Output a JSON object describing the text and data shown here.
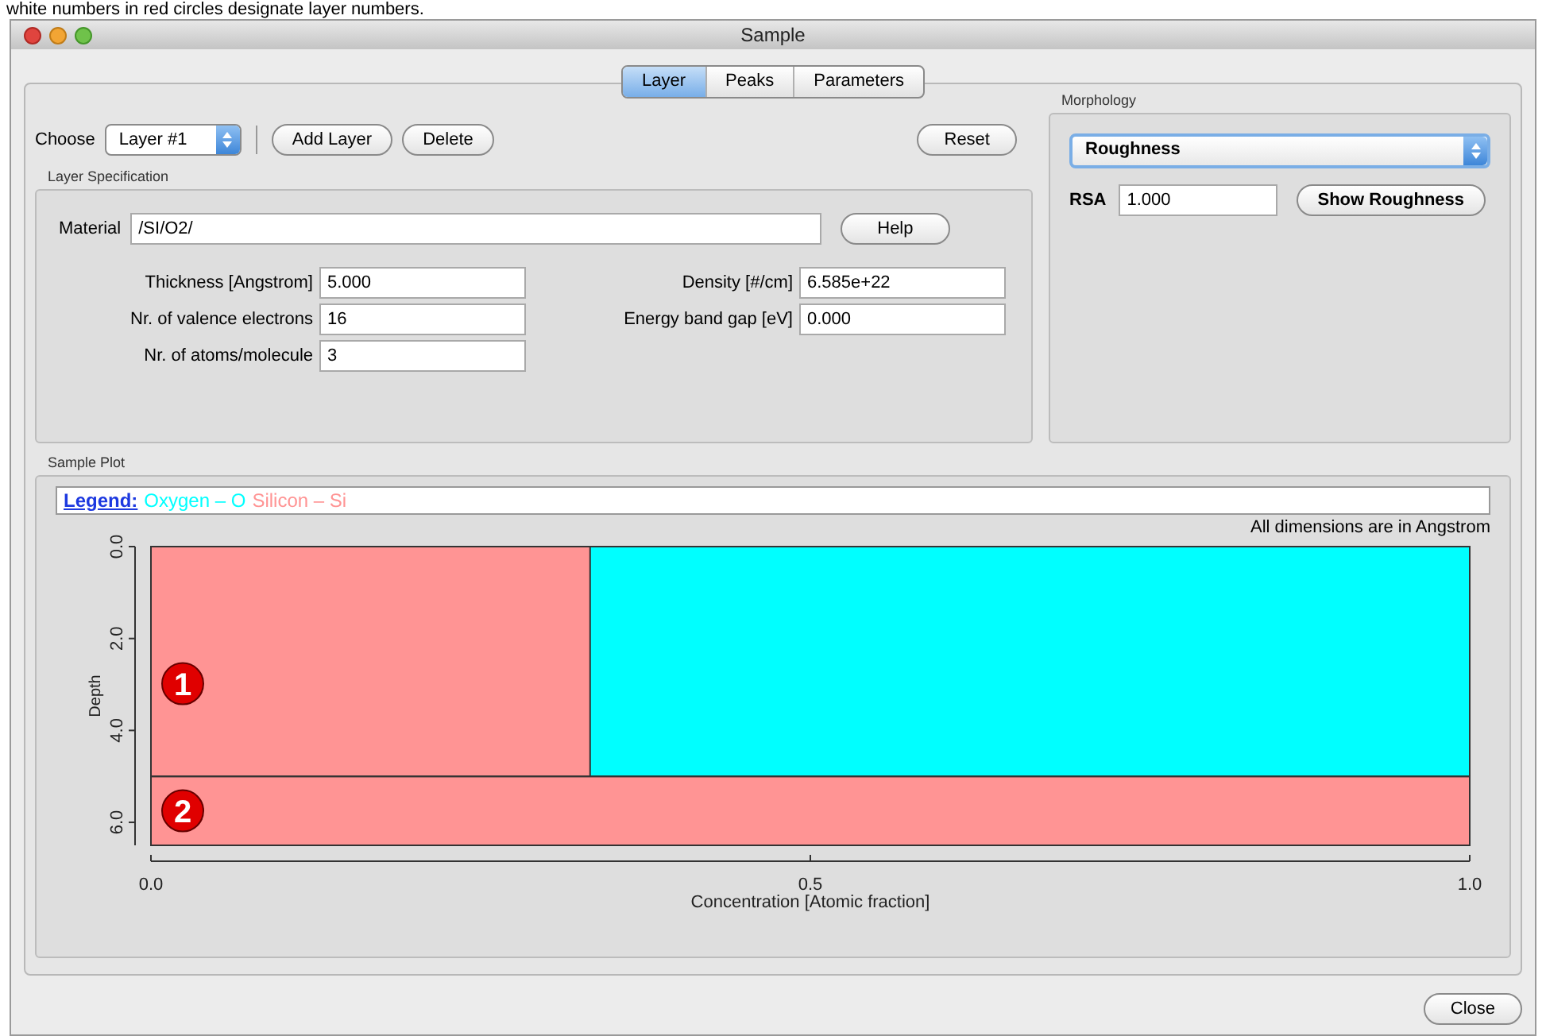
{
  "caption": "white numbers in red circles designate layer numbers.",
  "window": {
    "title": "Sample"
  },
  "tabs": [
    {
      "label": "Layer",
      "selected": true
    },
    {
      "label": "Peaks",
      "selected": false
    },
    {
      "label": "Parameters",
      "selected": false
    }
  ],
  "layer_bar": {
    "choose_label": "Choose",
    "layer_select": "Layer #1",
    "buttons": [
      "Add Layer",
      "Delete"
    ],
    "reset_button": "Reset"
  },
  "layer_specification": {
    "title": "Layer Specification",
    "material": {
      "label": "Material",
      "value": "/SI/O2/"
    },
    "help_button": "Help",
    "fields": [
      {
        "label": "Thickness [Angstrom]",
        "value": "5.000"
      },
      {
        "label": "Density [#/cm]",
        "value": "6.585e+22"
      },
      {
        "label": "Nr. of valence electrons",
        "value": "16"
      },
      {
        "label": "Energy band gap [eV]",
        "value": "0.000"
      },
      {
        "label": "Nr. of atoms/molecule",
        "value": "3"
      }
    ]
  },
  "morphology": {
    "title": "Morphology",
    "select": "Roughness",
    "rsa_label": "RSA",
    "rsa_value": "1.000",
    "show_button": "Show Roughness"
  },
  "sample_plot": {
    "title": "Sample Plot",
    "legend_label": "Legend:",
    "note": "All dimensions are in Angstrom",
    "chart_data": {
      "type": "bar",
      "orientation": "horizontal",
      "stacked": true,
      "xlabel": "Concentration [Atomic fraction]",
      "ylabel": "Depth",
      "categories": [
        "1",
        "2"
      ],
      "series": [
        {
          "name": "Oxygen – O",
          "color": "#00ffff",
          "values": [
            0.667,
            0
          ]
        },
        {
          "name": "Silicon – Si",
          "color": "#ff9494",
          "values": [
            0.333,
            1.0
          ]
        }
      ],
      "xlim": [
        0,
        1
      ],
      "xticks": [
        {
          "value": 0,
          "label": "0.0"
        },
        {
          "value": 0.5,
          "label": "0.5"
        },
        {
          "value": 1,
          "label": "1.0"
        }
      ]
    },
    "depth_ticks": [
      "0.0",
      "2.0",
      "4.0",
      "6.0"
    ]
  },
  "close_button": "Close"
}
